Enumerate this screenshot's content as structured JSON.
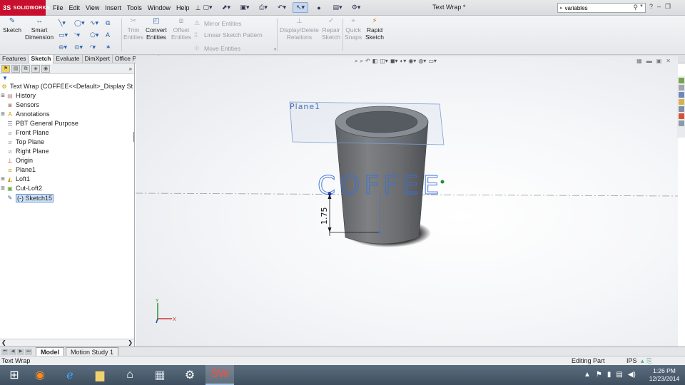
{
  "app": {
    "logo": "SOLIDWORKS",
    "window_title": "Text Wrap *"
  },
  "menus": [
    "File",
    "Edit",
    "View",
    "Insert",
    "Tools",
    "Window",
    "Help"
  ],
  "search": {
    "value": "variables"
  },
  "ribbon": {
    "sketch": "Sketch",
    "smart_dimension_1": "Smart",
    "smart_dimension_2": "Dimension",
    "trim_1": "Trim",
    "trim_2": "Entities",
    "convert_1": "Convert",
    "convert_2": "Entities",
    "offset_1": "Offset",
    "offset_2": "Entities",
    "mirror": "Mirror Entities",
    "linear_pattern": "Linear Sketch Pattern",
    "move": "Move Entities",
    "display_delete_1": "Display/Delete",
    "display_delete_2": "Relations",
    "repair_1": "Repair",
    "repair_2": "Sketch",
    "quick_snaps_1": "Quick",
    "quick_snaps_2": "Snaps",
    "rapid_sketch_1": "Rapid",
    "rapid_sketch_2": "Sketch"
  },
  "command_tabs": [
    "Features",
    "Sketch",
    "Evaluate",
    "DimXpert",
    "Office Products"
  ],
  "active_command_tab": "Sketch",
  "feature_tree": {
    "root": "Text Wrap  (COFFEE<<Default>_Display St",
    "items": [
      {
        "label": "History",
        "icon": "history-folder-icon",
        "expandable": true
      },
      {
        "label": "Sensors",
        "icon": "sensors-icon",
        "expandable": false
      },
      {
        "label": "Annotations",
        "icon": "annotations-icon",
        "expandable": true
      },
      {
        "label": "PBT General Purpose",
        "icon": "material-icon",
        "expandable": false
      },
      {
        "label": "Front Plane",
        "icon": "plane-icon",
        "expandable": false
      },
      {
        "label": "Top Plane",
        "icon": "plane-icon",
        "expandable": false
      },
      {
        "label": "Right Plane",
        "icon": "plane-icon",
        "expandable": false
      },
      {
        "label": "Origin",
        "icon": "origin-icon",
        "expandable": false
      },
      {
        "label": "Plane1",
        "icon": "plane-icon",
        "expandable": false
      },
      {
        "label": "Loft1",
        "icon": "loft-icon",
        "expandable": true
      },
      {
        "label": "Cut-Loft2",
        "icon": "cut-loft-icon",
        "expandable": true
      },
      {
        "label": "(-) Sketch15",
        "icon": "sketch-icon",
        "expandable": false,
        "selected": true
      }
    ]
  },
  "viewport": {
    "plane_label": "Plane1",
    "wrap_text": "COFFEE",
    "dimension_value": "1.75",
    "triad_axes": [
      "Y",
      "X"
    ]
  },
  "bottom_tabs": [
    "Model",
    "Motion Study 1"
  ],
  "active_bottom_tab": "Model",
  "status": {
    "left": "Text Wrap",
    "mode": "Editing Part",
    "units": "IPS"
  },
  "taskbar": {
    "time": "1:26 PM",
    "date": "12/23/2014"
  },
  "colors": {
    "logo_red": "#c8102e",
    "selection_blue": "#3a6fd8",
    "cup_gray": "#6b6d70",
    "taskbar": "#4b5b6c"
  }
}
